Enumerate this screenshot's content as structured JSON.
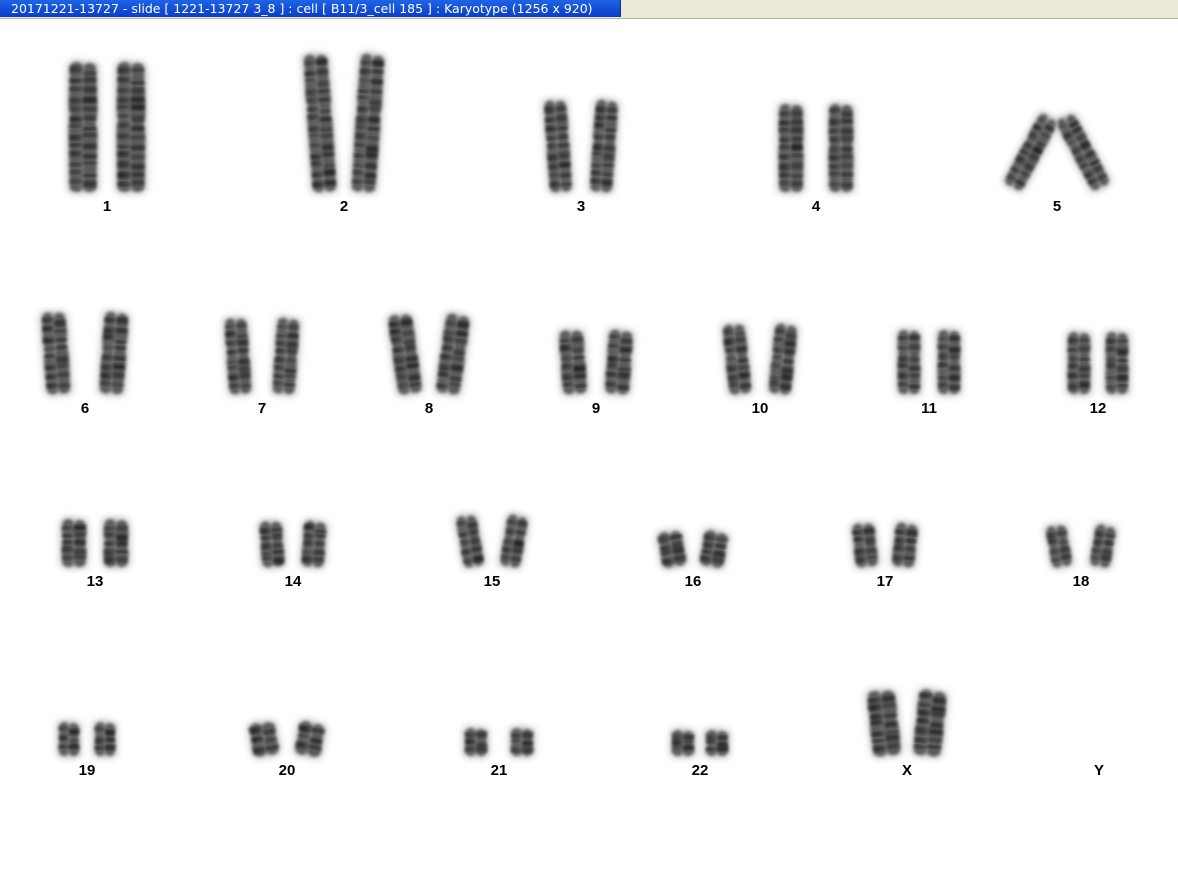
{
  "window": {
    "title": "20171221-13727 - slide [ 1221-13727 3_8 ] : cell [ B11/3_cell 185 ] : Karyotype  (1256 x 920)"
  },
  "karyotype": {
    "chromosomes": [
      {
        "label": "1",
        "count": 2
      },
      {
        "label": "2",
        "count": 2
      },
      {
        "label": "3",
        "count": 2
      },
      {
        "label": "4",
        "count": 2
      },
      {
        "label": "5",
        "count": 2
      },
      {
        "label": "6",
        "count": 2
      },
      {
        "label": "7",
        "count": 2
      },
      {
        "label": "8",
        "count": 2
      },
      {
        "label": "9",
        "count": 2
      },
      {
        "label": "10",
        "count": 2
      },
      {
        "label": "11",
        "count": 2
      },
      {
        "label": "12",
        "count": 2
      },
      {
        "label": "13",
        "count": 2
      },
      {
        "label": "14",
        "count": 2
      },
      {
        "label": "15",
        "count": 2
      },
      {
        "label": "16",
        "count": 2
      },
      {
        "label": "17",
        "count": 2
      },
      {
        "label": "18",
        "count": 2
      },
      {
        "label": "19",
        "count": 2
      },
      {
        "label": "20",
        "count": 2
      },
      {
        "label": "21",
        "count": 2
      },
      {
        "label": "22",
        "count": 2
      },
      {
        "label": "X",
        "count": 2
      },
      {
        "label": "Y",
        "count": 0
      }
    ]
  },
  "colors": {
    "titlebar": "#0a3ec7",
    "chromatin": "#222222",
    "background": "#ffffff"
  }
}
